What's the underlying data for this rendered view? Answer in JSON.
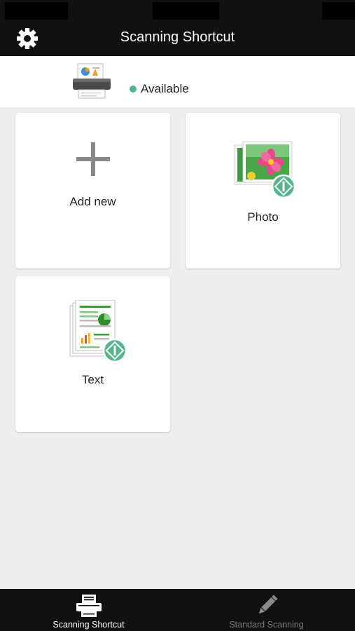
{
  "header": {
    "title": "Scanning Shortcut",
    "settings_icon": "gear-icon"
  },
  "device": {
    "icon": "scanner-icon",
    "status": "Available",
    "status_color": "#55b38e"
  },
  "cards": [
    {
      "label": "Add new",
      "icon": "plus-icon"
    },
    {
      "label": "Photo",
      "icon": "photo-scan-icon"
    },
    {
      "label": "Text",
      "icon": "document-scan-icon"
    }
  ],
  "tabs": [
    {
      "label": "Scanning Shortcut",
      "icon": "scanner-tab-icon",
      "active": true
    },
    {
      "label": "Standard Scanning",
      "icon": "pencil-icon",
      "active": false
    }
  ],
  "colors": {
    "bar_background": "#111111",
    "page_background": "#eeeeee",
    "accent_green": "#55b38e",
    "tab_inactive": "#7a7a7a"
  }
}
